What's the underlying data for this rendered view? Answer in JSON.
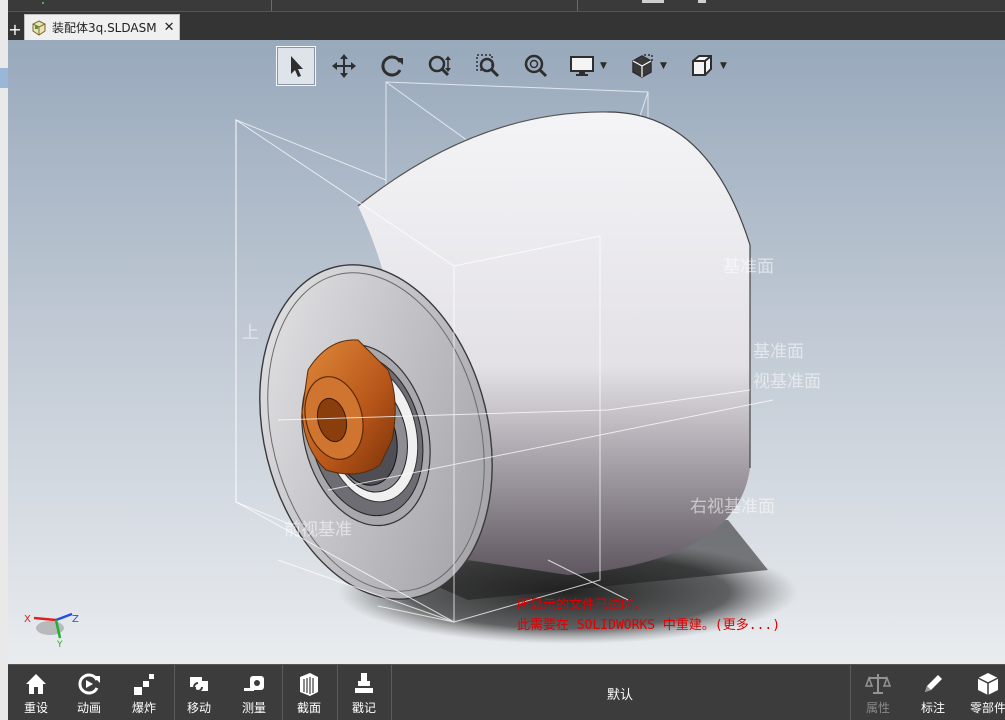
{
  "document_tab": {
    "add_glyph": "+",
    "title": "装配体3q.SLDASM",
    "close_glyph": "✕"
  },
  "hud_toolbar": [
    {
      "name": "select-tool-button",
      "icon": "arrow-cursor-icon"
    },
    {
      "name": "pan-tool-button",
      "icon": "move-arrows-icon"
    },
    {
      "name": "rotate-tool-button",
      "icon": "rotate-icon"
    },
    {
      "name": "zoom-tool-button",
      "icon": "zoom-in-out-icon"
    },
    {
      "name": "zoom-area-button",
      "icon": "zoom-area-icon"
    },
    {
      "name": "zoom-fit-button",
      "icon": "zoom-fit-icon"
    },
    {
      "name": "display-style-button",
      "icon": "monitor-icon"
    },
    {
      "name": "section-view-button",
      "icon": "section-cube-icon"
    },
    {
      "name": "view-orientation-button",
      "icon": "cube-icon"
    }
  ],
  "plane_labels": {
    "upper_right": "基准面",
    "right_mid_1": "基准面",
    "right_mid_2": "视基准面",
    "right_lower": "右视基准面",
    "left_lower": "前视基准",
    "left_upper": "上"
  },
  "triad": {
    "x": "X",
    "y": "Y",
    "z": "Z"
  },
  "warning": {
    "line1": "所显示的文件已过时。",
    "line2": "此需要在 SOLIDWORKS 中重建。(更多...)"
  },
  "bottom_toolbar": {
    "reset": "重设",
    "animate": "动画",
    "explode": "爆炸",
    "move": "移动",
    "measure": "测量",
    "section": "截面",
    "markup": "戳记",
    "configuration": "默认",
    "properties": "属性",
    "annotate": "标注",
    "components": "零部件"
  },
  "colors": {
    "viewport_top": "#98a9bc",
    "viewport_bottom": "#e9ecef",
    "bushing": "#c8641a",
    "warning_text": "#e00000",
    "toolbar_bg": "#3c3c3c"
  }
}
